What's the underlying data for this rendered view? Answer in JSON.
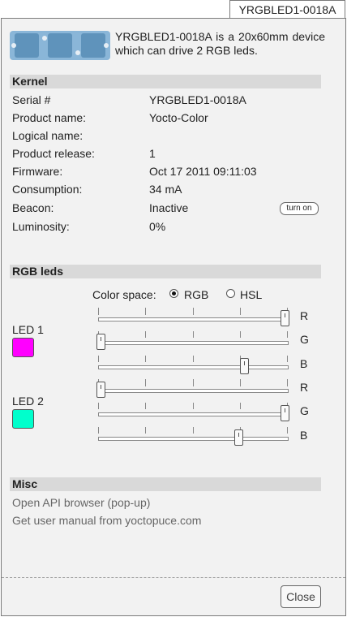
{
  "tab_title": "YRGBLED1-0018A",
  "description": "YRGBLED1-0018A is a 20x60mm device which can drive 2 RGB leds.",
  "kernel": {
    "heading": "Kernel",
    "rows": [
      {
        "label": "Serial #",
        "value": "YRGBLED1-0018A"
      },
      {
        "label": "Product name:",
        "value": "Yocto-Color"
      },
      {
        "label": "Logical name:",
        "value": ""
      },
      {
        "label": "Product release:",
        "value": "1"
      },
      {
        "label": "Firmware:",
        "value": "Oct 17 2011 09:11:03"
      },
      {
        "label": "Consumption:",
        "value": "34 mA"
      },
      {
        "label": "Beacon:",
        "value": "Inactive"
      },
      {
        "label": "Luminosity:",
        "value": "0%"
      }
    ],
    "beacon_button": "turn on"
  },
  "rgb": {
    "heading": "RGB leds",
    "colorspace_label": "Color space:",
    "colorspace_options": [
      "RGB",
      "HSL"
    ],
    "colorspace_selected": "RGB",
    "channel_labels": [
      "R",
      "G",
      "B"
    ],
    "leds": [
      {
        "label": "LED 1",
        "color": "#ff00ff",
        "r": 1.0,
        "g": 0.0,
        "b": 0.78
      },
      {
        "label": "LED 2",
        "color": "#00ffcc",
        "r": 0.0,
        "g": 1.0,
        "b": 0.75
      }
    ]
  },
  "misc": {
    "heading": "Misc",
    "links": [
      "Open API browser (pop-up)",
      "Get user manual from yoctopuce.com"
    ]
  },
  "close_label": "Close"
}
